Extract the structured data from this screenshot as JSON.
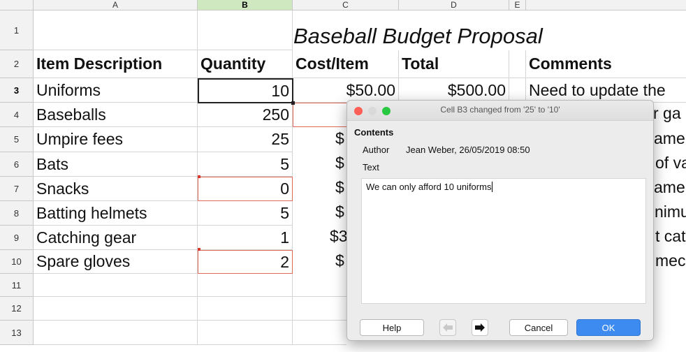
{
  "columns": [
    "A",
    "B",
    "C",
    "D",
    "E"
  ],
  "rows": [
    "1",
    "2",
    "3",
    "4",
    "5",
    "6",
    "7",
    "8",
    "9",
    "10",
    "11",
    "12",
    "13"
  ],
  "title": "Baseball Budget Proposal",
  "headers": {
    "a": "Item Description",
    "b": "Quantity",
    "c": "Cost/Item",
    "d": "Total",
    "f": "Comments"
  },
  "items": [
    {
      "desc": "Uniforms",
      "qty": "10",
      "cost": "$50.00",
      "total": "$500.00",
      "comment": "Need to update the"
    },
    {
      "desc": "Baseballs",
      "qty": "250",
      "cost_cut": "",
      "comment_cut": "r ga"
    },
    {
      "desc": "Umpire fees",
      "qty": "25",
      "cost_cut": "$",
      "comment_cut": "ame"
    },
    {
      "desc": "Bats",
      "qty": "5",
      "cost_cut": "$",
      "comment_cut": "of va"
    },
    {
      "desc": "Snacks",
      "qty": "0",
      "cost_cut": "$",
      "comment_cut": "ame"
    },
    {
      "desc": "Batting helmets",
      "qty": "5",
      "cost_cut": "$",
      "comment_cut": "nimu"
    },
    {
      "desc": "Catching gear",
      "qty": "1",
      "cost_cut": "$3",
      "comment_cut": "t cat"
    },
    {
      "desc": "Spare gloves",
      "qty": "2",
      "cost_cut": "$",
      "comment_cut": "mec"
    }
  ],
  "dialog": {
    "title": "Cell B3 changed from '25' to '10'",
    "contents_label": "Contents",
    "author_label": "Author",
    "author_value": "Jean Weber, 26/05/2019 08:50",
    "text_label": "Text",
    "text_value": "We can only afford 10 uniforms",
    "help": "Help",
    "cancel": "Cancel",
    "ok": "OK",
    "colors": {
      "close": "#ff5f57",
      "min": "#d9d9d9",
      "max": "#28c840",
      "ok": "#3d8bf1"
    }
  }
}
